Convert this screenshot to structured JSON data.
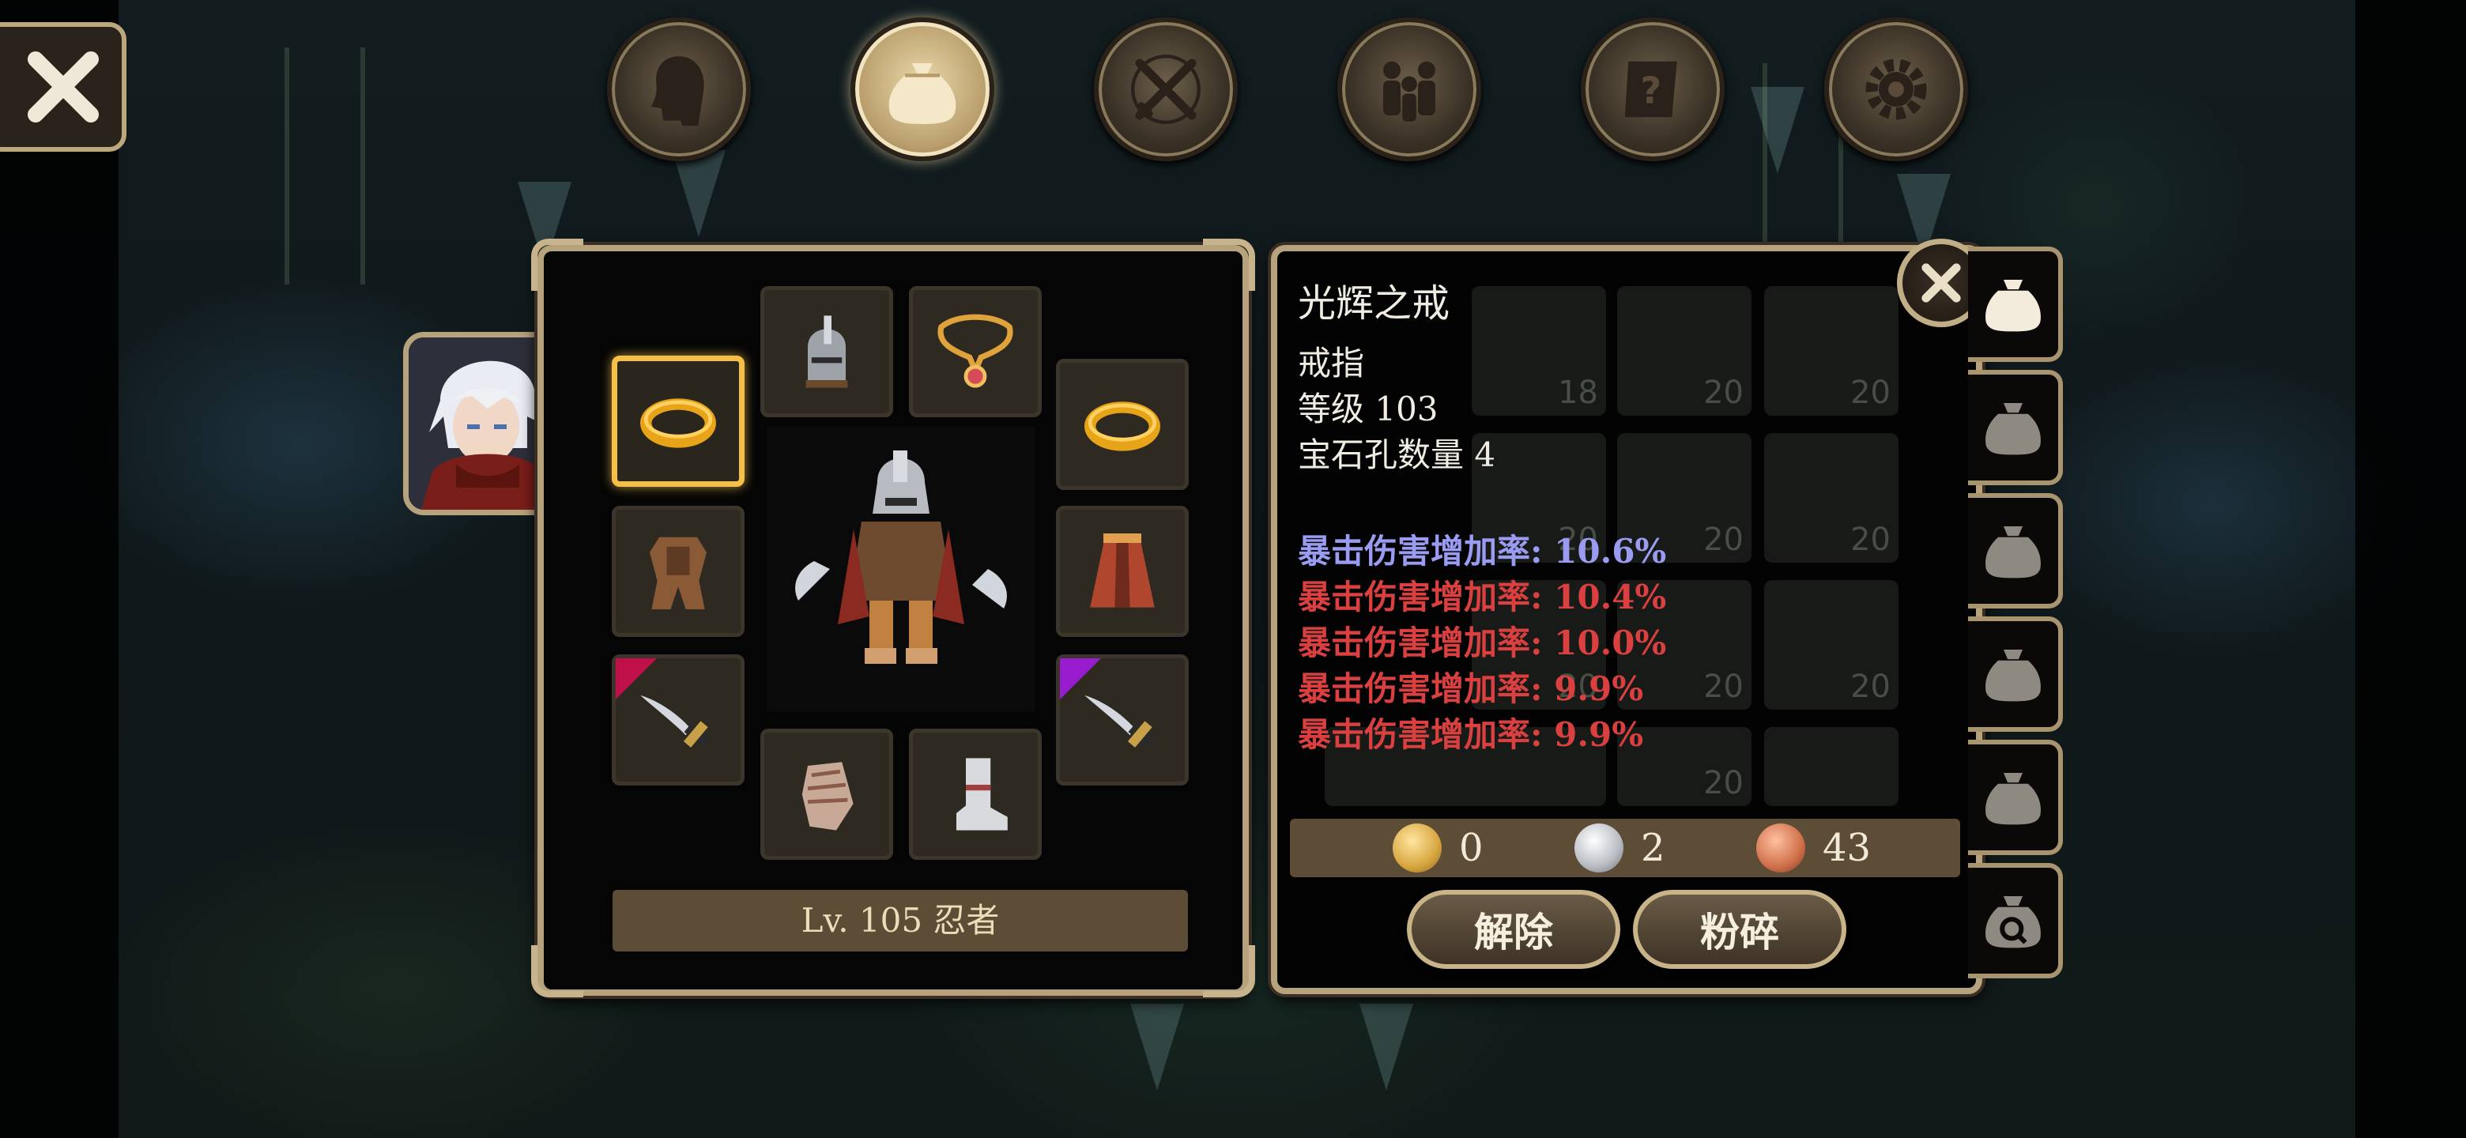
{
  "top_tabs": [
    {
      "name": "profile-tab",
      "icon": "head-silhouette-icon",
      "active": false
    },
    {
      "name": "bag-tab",
      "icon": "bag-icon",
      "active": true
    },
    {
      "name": "skills-tab",
      "icon": "crossed-swords-icon",
      "active": false
    },
    {
      "name": "party-tab",
      "icon": "people-icon",
      "active": false
    },
    {
      "name": "quest-tab",
      "icon": "scroll-question-icon",
      "active": false
    },
    {
      "name": "settings-tab",
      "icon": "gear-icon",
      "active": false
    }
  ],
  "equipment": {
    "character_label": "Lv. 105 忍者",
    "slots": [
      {
        "name": "helmet-slot",
        "icon": "helmet-icon"
      },
      {
        "name": "necklace-slot",
        "icon": "necklace-icon"
      },
      {
        "name": "ring-left-slot",
        "icon": "gold-ring-icon",
        "selected": true
      },
      {
        "name": "ring-right-slot",
        "icon": "gold-ring-icon"
      },
      {
        "name": "armor-slot",
        "icon": "armor-icon"
      },
      {
        "name": "cloak-slot",
        "icon": "cloak-icon"
      },
      {
        "name": "weapon-left-slot",
        "icon": "dagger-icon",
        "rarity": "crimson"
      },
      {
        "name": "weapon-right-slot",
        "icon": "dagger-icon",
        "rarity": "purple"
      },
      {
        "name": "gloves-slot",
        "icon": "gauntlet-icon"
      },
      {
        "name": "boots-slot",
        "icon": "boots-icon"
      }
    ]
  },
  "item": {
    "name": "光辉之戒",
    "type": "戒指",
    "level_text": "等级 103",
    "sockets_text": "宝石孔数量 4",
    "attributes": [
      {
        "text": "暴击伤害增加率: 10.6%",
        "color": "#9a9cf2"
      },
      {
        "text": "暴击伤害增加率: 10.4%",
        "color": "#d9403f"
      },
      {
        "text": "暴击伤害增加率: 10.0%",
        "color": "#d9403f"
      },
      {
        "text": "暴击伤害增加率: 9.9%",
        "color": "#d9403f"
      },
      {
        "text": "暴击伤害增加率: 9.9%",
        "color": "#d9403f"
      }
    ]
  },
  "currency": {
    "gold": "0",
    "silver": "2",
    "copper": "43"
  },
  "buttons": {
    "unequip": "解除",
    "smash": "粉碎"
  },
  "background_grid_counts": [
    "18",
    "20",
    "20",
    "20",
    "20",
    "20",
    "20",
    "20",
    "20",
    "20"
  ],
  "colors": {
    "frame": "#b6a27c",
    "selected_slot": "#f4c04a",
    "bar": "#5d4d36"
  }
}
